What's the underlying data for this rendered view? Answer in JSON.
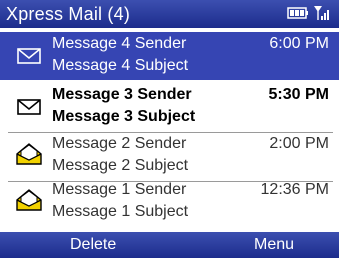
{
  "title": "Xpress Mail (4)",
  "status_icons": [
    "battery-icon",
    "signal-icon"
  ],
  "messages": [
    {
      "sender": "Message 4 Sender",
      "subject": "Message 4 Subject",
      "time": "6:00 PM",
      "state": "selected",
      "icon": "envelope-closed-icon"
    },
    {
      "sender": "Message 3 Sender",
      "subject": "Message 3 Subject",
      "time": "5:30 PM",
      "state": "unread",
      "icon": "envelope-closed-icon"
    },
    {
      "sender": "Message 2 Sender",
      "subject": "Message 2 Subject",
      "time": "2:00 PM",
      "state": "read",
      "icon": "envelope-open-icon"
    },
    {
      "sender": "Message 1 Sender",
      "subject": "Message 1 Subject",
      "time": "12:36 PM",
      "state": "read",
      "icon": "envelope-open-icon"
    }
  ],
  "softkeys": {
    "left": "Delete",
    "right": "Menu"
  },
  "colors": {
    "bar": "#2a3aa0",
    "selected_row": "#3645b3",
    "open_envelope": "#f2d200"
  }
}
